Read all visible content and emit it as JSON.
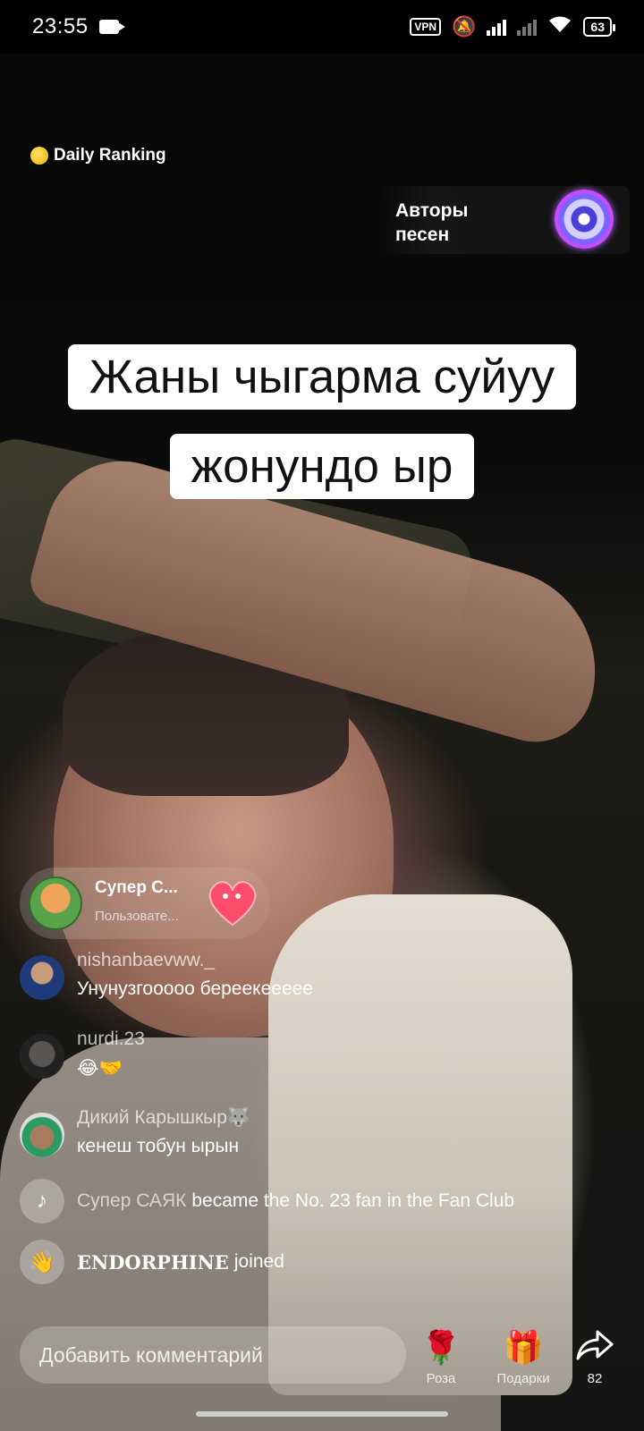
{
  "status_bar": {
    "time": "23:55",
    "vpn": "VPN",
    "battery": "63"
  },
  "overlay": {
    "ranking": "Daily Ranking",
    "authors_label": "Авторы песен",
    "caption_line1": "Жаны чыгарма суйуу",
    "caption_line2": "жонундо ыр"
  },
  "gift_banner": {
    "name": "Супер С...",
    "subtitle": "Пользовате..."
  },
  "comments": [
    {
      "user": "nishanbaevww._",
      "text": "Унунузгооооо береекееееe"
    },
    {
      "user": "nurdi.23",
      "text": "😂🤝"
    },
    {
      "user": "Дикий Карышкыр🐺",
      "text": "кенеш тобун ырын"
    }
  ],
  "system_messages": [
    {
      "who": "Супер САЯК",
      "text": "became the No. 23 fan in the Fan Club"
    },
    {
      "who": "𝐄𝐍𝐃𝐎𝐑𝐏𝐇𝐈𝐍𝐄",
      "text": "joined"
    }
  ],
  "bottom_bar": {
    "comment_placeholder": "Добавить комментарий",
    "rose_label": "Роза",
    "gifts_label": "Подарки",
    "share_count": "82"
  },
  "colors": {
    "accent_pink": "#ff3b7a",
    "caption_bg": "#ffffff"
  }
}
